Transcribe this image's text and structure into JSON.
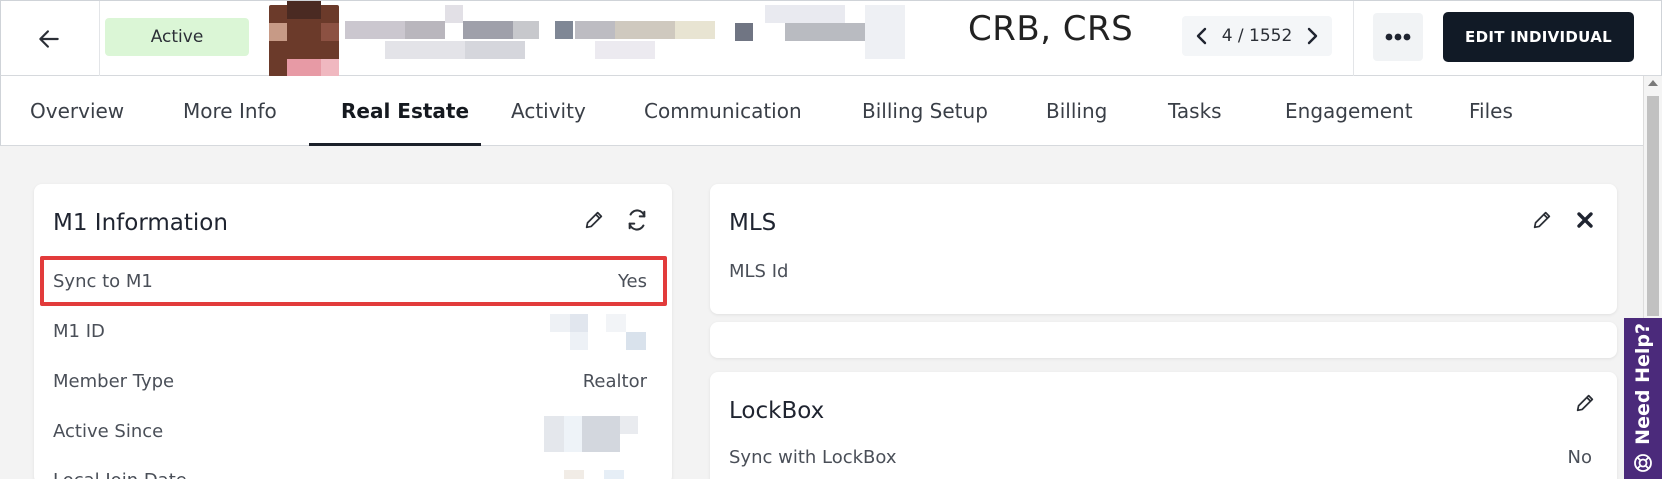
{
  "header": {
    "status": "Active",
    "name_suffix": "CRB, CRS",
    "pager": {
      "current": "4",
      "separator": "/",
      "total": "1552",
      "label": "4 / 1552"
    },
    "edit_label": "EDIT INDIVIDUAL",
    "icons": {
      "back": "arrow-left-icon",
      "prev": "chevron-left-icon",
      "next": "chevron-right-icon",
      "more": "more-horizontal-icon"
    }
  },
  "tabs": [
    {
      "label": "Overview",
      "active": false
    },
    {
      "label": "More Info",
      "active": false
    },
    {
      "label": "Real Estate",
      "active": true
    },
    {
      "label": "Activity",
      "active": false
    },
    {
      "label": "Communication",
      "active": false
    },
    {
      "label": "Billing Setup",
      "active": false
    },
    {
      "label": "Billing",
      "active": false
    },
    {
      "label": "Tasks",
      "active": false
    },
    {
      "label": "Engagement",
      "active": false
    },
    {
      "label": "Files",
      "active": false
    }
  ],
  "m1_card": {
    "title": "M1 Information",
    "rows": [
      {
        "label": "Sync to M1",
        "value": "Yes"
      },
      {
        "label": "M1 ID",
        "value": ""
      },
      {
        "label": "Member Type",
        "value": "Realtor"
      },
      {
        "label": "Active Since",
        "value": ""
      },
      {
        "label": "Local Join Date",
        "value": ""
      }
    ]
  },
  "mls_card": {
    "title": "MLS",
    "field_label": "MLS Id"
  },
  "lockbox_card": {
    "title": "LockBox",
    "field_label": "Sync with LockBox",
    "field_value": "No"
  },
  "need_help": {
    "label": "Need Help?"
  },
  "colors": {
    "accent": "#111a26",
    "status_bg": "#dbf6d6",
    "highlight": "#e23b3b",
    "help_bg": "#4b2a7b"
  }
}
